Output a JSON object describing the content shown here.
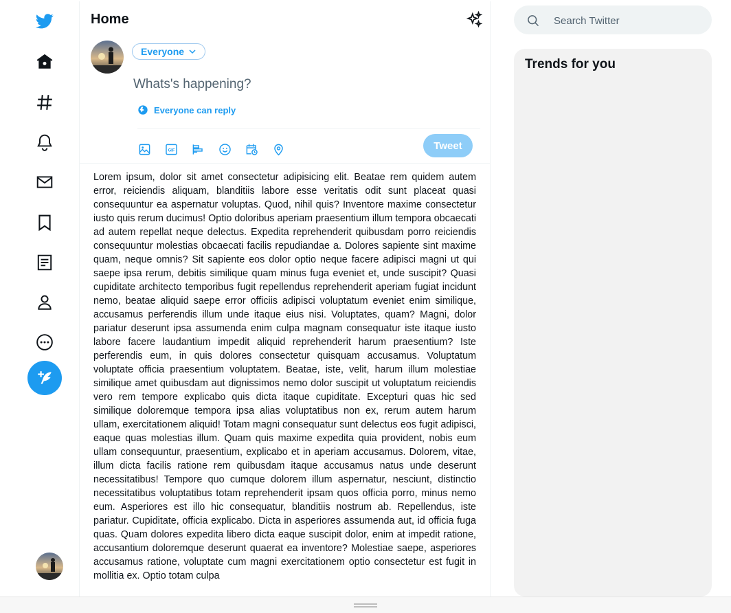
{
  "app": {
    "name": "Twitter",
    "brand_color": "#1d9bf0"
  },
  "nav": {
    "logo_icon": "twitter-bird-icon",
    "items": [
      {
        "icon": "home-icon"
      },
      {
        "icon": "hashtag-explore-icon"
      },
      {
        "icon": "bell-notifications-icon"
      },
      {
        "icon": "envelope-messages-icon"
      },
      {
        "icon": "bookmark-icon"
      },
      {
        "icon": "list-icon"
      },
      {
        "icon": "profile-icon"
      },
      {
        "icon": "more-circle-icon"
      }
    ],
    "compose_icon": "feather-compose-icon"
  },
  "header": {
    "title": "Home",
    "sparkle_icon": "sparkle-icon"
  },
  "composer": {
    "audience": "Everyone",
    "placeholder": "Whats's happening?",
    "reply_setting": "Everyone can reply",
    "tools": [
      "image-icon",
      "gif-icon",
      "poll-icon",
      "emoji-icon",
      "schedule-icon",
      "location-icon"
    ],
    "tweet_label": "Tweet",
    "tweet_disabled_color": "#8ecdf8"
  },
  "feed": {
    "text": "Lorem ipsum, dolor sit amet consectetur adipisicing elit. Beatae rem quidem autem error, reiciendis aliquam, blanditiis labore esse veritatis odit sunt placeat quasi consequuntur ea aspernatur voluptas. Quod, nihil quis? Inventore maxime consectetur iusto quis rerum ducimus! Optio doloribus aperiam praesentium illum tempora obcaecati ad autem repellat neque delectus. Expedita reprehenderit quibusdam porro reiciendis consequuntur molestias obcaecati facilis repudiandae a. Dolores sapiente sint maxime quam, neque omnis? Sit sapiente eos dolor optio neque facere adipisci magni ut qui saepe ipsa rerum, debitis similique quam minus fuga eveniet et, unde suscipit? Quasi cupiditate architecto temporibus fugit repellendus reprehenderit aperiam fugiat incidunt nemo, beatae aliquid saepe error officiis adipisci voluptatum eveniet enim similique, accusamus perferendis illum unde itaque eius nisi. Voluptates, quam? Magni, dolor pariatur deserunt ipsa assumenda enim culpa magnam consequatur iste itaque iusto labore facere laudantium impedit aliquid reprehenderit harum praesentium? Iste perferendis eum, in quis dolores consectetur quisquam accusamus. Voluptatum voluptate officia praesentium voluptatem. Beatae, iste, velit, harum illum molestiae similique amet quibusdam aut dignissimos nemo dolor suscipit ut voluptatum reiciendis vero rem tempore explicabo quis dicta itaque cupiditate. Excepturi quas hic sed similique doloremque tempora ipsa alias voluptatibus non ex, rerum autem harum ullam, exercitationem aliquid! Totam magni consequatur sunt delectus eos fugit adipisci, eaque quas molestias illum. Quam quis maxime expedita quia provident, nobis eum ullam consequuntur, praesentium, explicabo et in aperiam accusamus. Dolorem, vitae, illum dicta facilis ratione rem quibusdam itaque accusamus natus unde deserunt necessitatibus! Tempore quo cumque dolorem illum aspernatur, nesciunt, distinctio necessitatibus voluptatibus totam reprehenderit ipsam quos officia porro, minus nemo eum. Asperiores est illo hic consequatur, blanditiis nostrum ab. Repellendus, iste pariatur. Cupiditate, officia explicabo. Dicta in asperiores assumenda aut, id officia fuga quas. Quam dolores expedita libero dicta eaque suscipit dolor, enim at impedit ratione, accusantium doloremque deserunt quaerat ea inventore? Molestiae saepe, asperiores accusamus ratione, voluptate cum magni exercitationem optio consectetur est fugit in mollitia ex. Optio totam culpa"
  },
  "search": {
    "placeholder": "Search Twitter"
  },
  "trends": {
    "title": "Trends for you"
  }
}
